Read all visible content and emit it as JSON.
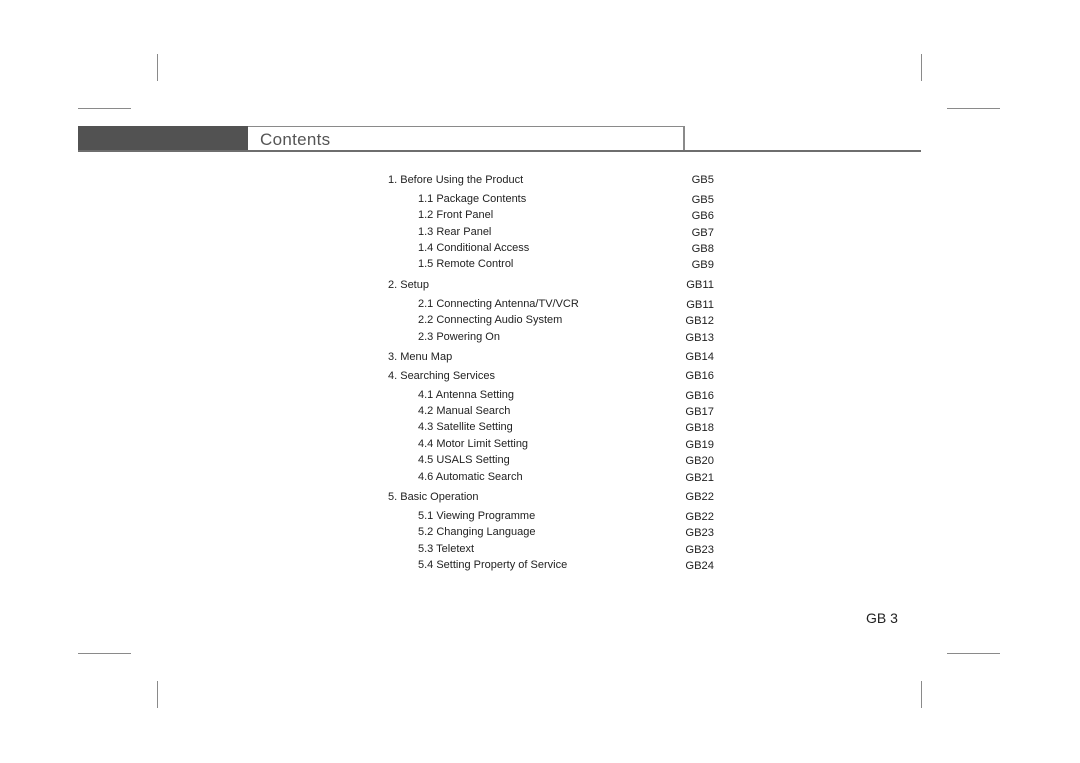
{
  "header": {
    "title": "Contents"
  },
  "toc": {
    "sections": [
      {
        "label": "1. Before Using the Product",
        "page": "GB5",
        "items": [
          {
            "label": "1.1 Package Contents",
            "page": "GB5"
          },
          {
            "label": "1.2 Front Panel",
            "page": "GB6"
          },
          {
            "label": "1.3 Rear Panel",
            "page": "GB7"
          },
          {
            "label": "1.4 Conditional Access",
            "page": "GB8"
          },
          {
            "label": "1.5 Remote Control",
            "page": "GB9"
          }
        ]
      },
      {
        "label": "2. Setup",
        "page": "GB11",
        "items": [
          {
            "label": "2.1 Connecting Antenna/TV/VCR",
            "page": "GB11"
          },
          {
            "label": "2.2 Connecting Audio System",
            "page": "GB12"
          },
          {
            "label": "2.3 Powering On",
            "page": "GB13"
          }
        ]
      },
      {
        "label": "3. Menu Map",
        "page": "GB14",
        "items": []
      },
      {
        "label": "4. Searching Services",
        "page": "GB16",
        "items": [
          {
            "label": "4.1 Antenna Setting",
            "page": "GB16"
          },
          {
            "label": "4.2 Manual Search",
            "page": "GB17"
          },
          {
            "label": "4.3 Satellite Setting",
            "page": "GB18"
          },
          {
            "label": "4.4 Motor Limit Setting",
            "page": "GB19"
          },
          {
            "label": "4.5 USALS Setting",
            "page": "GB20"
          },
          {
            "label": "4.6 Automatic Search",
            "page": "GB21"
          }
        ]
      },
      {
        "label": "5. Basic Operation",
        "page": "GB22",
        "items": [
          {
            "label": "5.1 Viewing Programme",
            "page": "GB22"
          },
          {
            "label": "5.2 Changing Language",
            "page": "GB23"
          },
          {
            "label": "5.3 Teletext",
            "page": "GB23"
          },
          {
            "label": "5.4 Setting Property of Service",
            "page": "GB24"
          }
        ]
      }
    ]
  },
  "footer": {
    "page_number": "GB 3"
  }
}
